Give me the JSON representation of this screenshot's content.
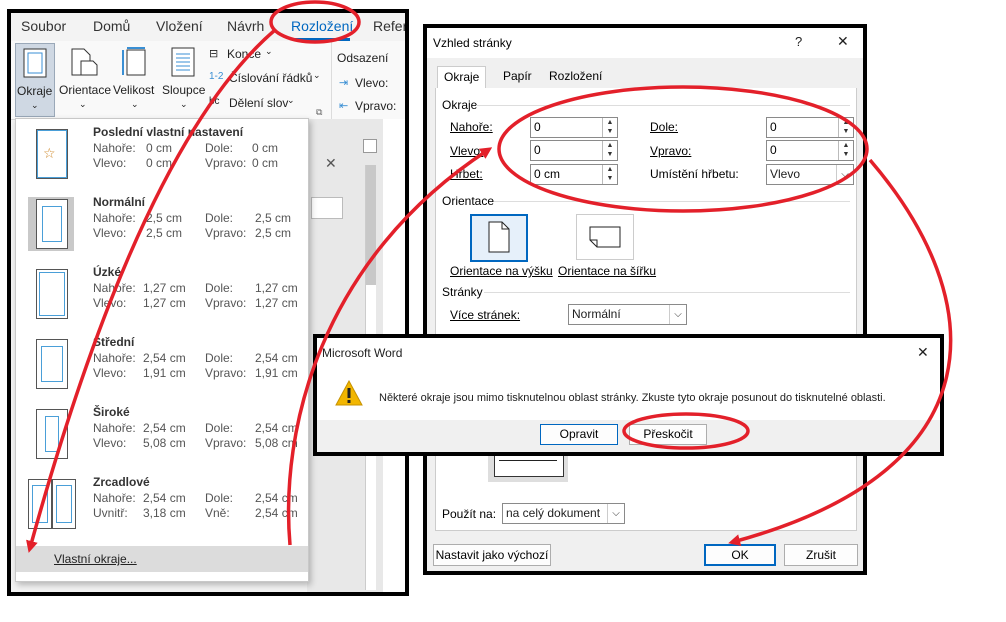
{
  "ribbon": {
    "tabs": [
      "Soubor",
      "Domů",
      "Vložení",
      "Návrh",
      "Rozložení",
      "Refer"
    ],
    "active_tab": "Rozložení",
    "buttons": {
      "margins": "Okraje",
      "orientation": "Orientace",
      "size": "Velikost",
      "columns": "Sloupce",
      "breaks": "Konce",
      "line_numbers": "Číslování řádků",
      "hyphenation": "Dělení slov",
      "indent_header": "Odsazení",
      "indent_left": "Vlevo:",
      "indent_right": "Vpravo:"
    }
  },
  "margins_menu": {
    "items": [
      {
        "title": "Poslední vlastní nastavení",
        "top_label": "Nahoře:",
        "top": "0 cm",
        "bottom_label": "Dole:",
        "bottom": "0 cm",
        "left_label": "Vlevo:",
        "left": "0 cm",
        "right_label": "Vpravo:",
        "right": "0 cm"
      },
      {
        "title": "Normální",
        "top_label": "Nahoře:",
        "top": "2,5 cm",
        "bottom_label": "Dole:",
        "bottom": "2,5 cm",
        "left_label": "Vlevo:",
        "left": "2,5 cm",
        "right_label": "Vpravo:",
        "right": "2,5 cm"
      },
      {
        "title": "Úzké",
        "top_label": "Nahoře:",
        "top": "1,27 cm",
        "bottom_label": "Dole:",
        "bottom": "1,27 cm",
        "left_label": "Vlevo:",
        "left": "1,27 cm",
        "right_label": "Vpravo:",
        "right": "1,27 cm"
      },
      {
        "title": "Střední",
        "top_label": "Nahoře:",
        "top": "2,54 cm",
        "bottom_label": "Dole:",
        "bottom": "2,54 cm",
        "left_label": "Vlevo:",
        "left": "1,91 cm",
        "right_label": "Vpravo:",
        "right": "1,91 cm"
      },
      {
        "title": "Široké",
        "top_label": "Nahoře:",
        "top": "2,54 cm",
        "bottom_label": "Dole:",
        "bottom": "2,54 cm",
        "left_label": "Vlevo:",
        "left": "5,08 cm",
        "right_label": "Vpravo:",
        "right": "5,08 cm"
      },
      {
        "title": "Zrcadlové",
        "top_label": "Nahoře:",
        "top": "2,54 cm",
        "bottom_label": "Dole:",
        "bottom": "2,54 cm",
        "left_label": "Uvnitř:",
        "left": "3,18 cm",
        "right_label": "Vně:",
        "right": "2,54 cm"
      }
    ],
    "custom": "Vlastní okraje..."
  },
  "dialog": {
    "title": "Vzhled stránky",
    "help": "?",
    "close": "✕",
    "tabs": [
      "Okraje",
      "Papír",
      "Rozložení"
    ],
    "margins_group": "Okraje",
    "fields": {
      "top_label": "Nahoře:",
      "top_value": "0",
      "bottom_label": "Dole:",
      "bottom_value": "0",
      "left_label": "Vlevo:",
      "left_value": "0",
      "right_label": "Vpravo:",
      "right_value": "0",
      "gutter_label": "Hřbet:",
      "gutter_value": "0 cm",
      "gutter_pos_label": "Umístění hřbetu:",
      "gutter_pos_value": "Vlevo"
    },
    "orientation_group": "Orientace",
    "portrait": "Orientace na výšku",
    "landscape": "Orientace na šířku",
    "pages_group": "Stránky",
    "multiple_pages_label": "Více stránek:",
    "multiple_pages_value": "Normální",
    "apply_to_label": "Použít na:",
    "apply_to_value": "na celý dokument",
    "set_default": "Nastavit jako výchozí",
    "ok": "OK",
    "cancel": "Zrušit"
  },
  "alert": {
    "title": "Microsoft Word",
    "close": "✕",
    "message": "Některé okraje jsou mimo tisknutelnou oblast stránky. Zkuste tyto okraje posunout do tisknutelné oblasti.",
    "fix": "Opravit",
    "ignore": "Přeskočit"
  },
  "colors": {
    "annotation": "#e3202a",
    "accent": "#0067c0",
    "warning": "#f2b600"
  }
}
